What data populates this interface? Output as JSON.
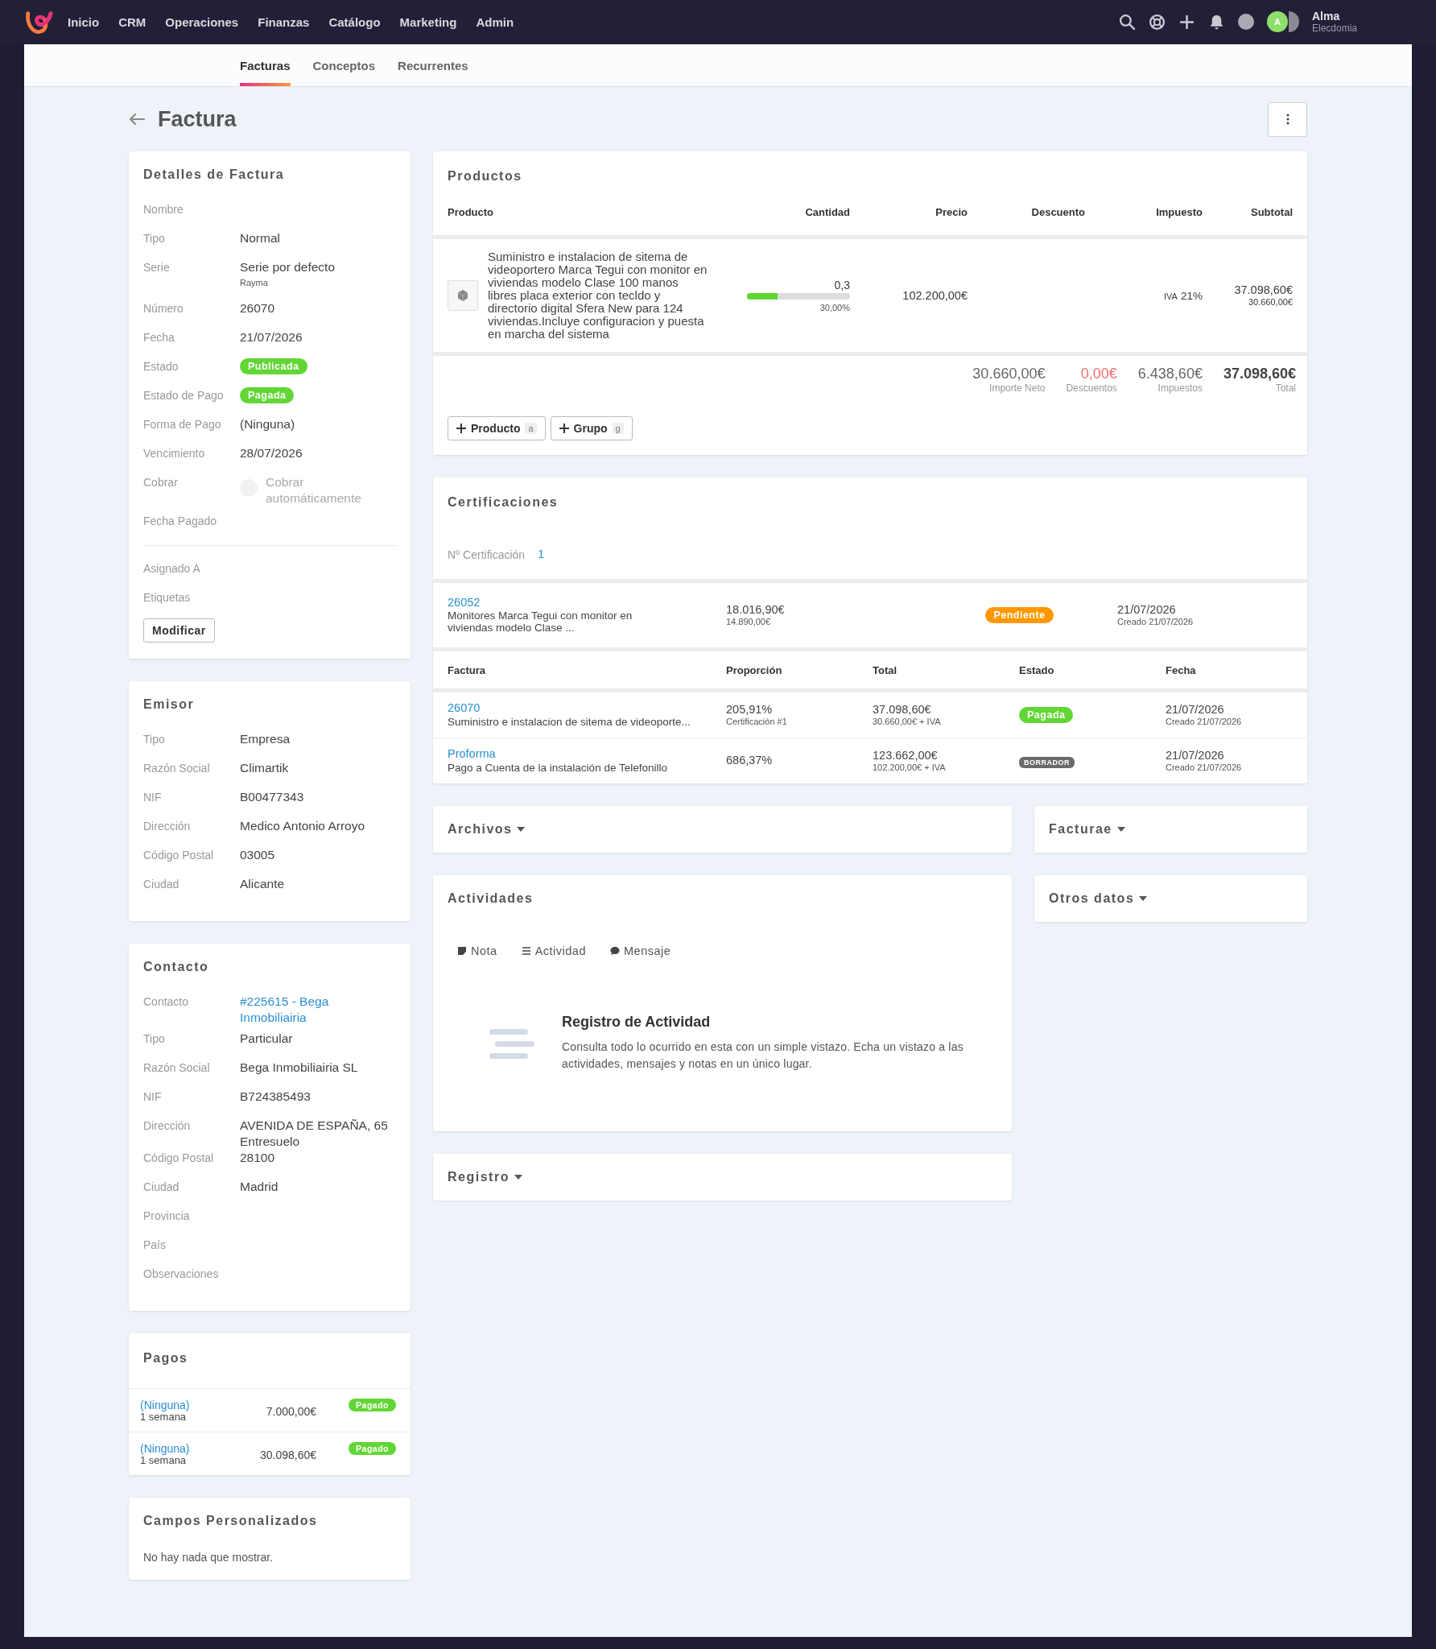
{
  "nav": {
    "items": [
      {
        "label": "Inicio"
      },
      {
        "label": "CRM"
      },
      {
        "label": "Operaciones"
      },
      {
        "label": "Finanzas"
      },
      {
        "label": "Catálogo"
      },
      {
        "label": "Marketing"
      },
      {
        "label": "Admin"
      }
    ],
    "user": {
      "name": "Alma",
      "company": "Elecdomia",
      "initial": "A"
    }
  },
  "tabs": [
    {
      "label": "Facturas",
      "selected": true
    },
    {
      "label": "Conceptos",
      "selected": false
    },
    {
      "label": "Recurrentes",
      "selected": false
    }
  ],
  "page": {
    "title": "Factura"
  },
  "details": {
    "title": "Detalles de Factura",
    "fields": [
      {
        "label": "Nombre"
      },
      {
        "label": "Tipo",
        "kind": "text",
        "value": "Normal"
      },
      {
        "label": "Serie",
        "kind": "text",
        "value": "Serie por defecto",
        "sub": "Rayma"
      },
      {
        "label": "Número",
        "kind": "text",
        "value": "26070"
      },
      {
        "label": "Fecha",
        "kind": "text",
        "value": "21/07/2026"
      },
      {
        "label": "Estado",
        "kind": "badge",
        "value": "Publicada",
        "color": "#62d634"
      },
      {
        "label": "Estado de Pago",
        "kind": "badge",
        "value": "Pagada",
        "color": "#62d634"
      },
      {
        "label": "Forma de Pago",
        "kind": "text",
        "value": "(Ninguna)"
      },
      {
        "label": "Vencimiento",
        "kind": "text",
        "value": "28/07/2026"
      },
      {
        "label": "Cobrar",
        "kind": "toggle",
        "value": "Cobrar automáticamente",
        "on": false
      },
      {
        "label": "Fecha Pagado"
      }
    ],
    "more_fields": [
      {
        "label": "Asignado A"
      },
      {
        "label": "Etiquetas"
      }
    ],
    "button": "Modificar"
  },
  "emisor": {
    "title": "Emisor",
    "fields": [
      {
        "label": "Tipo",
        "kind": "text",
        "value": "Empresa"
      },
      {
        "label": "Razón Social",
        "kind": "text",
        "value": "Climartik"
      },
      {
        "label": "NIF",
        "kind": "text",
        "value": "B00477343"
      },
      {
        "label": "Dirección",
        "kind": "text",
        "value": "Medico Antonio Arroyo"
      },
      {
        "label": "Código Postal",
        "kind": "text",
        "value": "03005"
      },
      {
        "label": "Ciudad",
        "kind": "text",
        "value": "Alicante"
      }
    ]
  },
  "contacto": {
    "title": "Contacto",
    "fields": [
      {
        "label": "Contacto",
        "kind": "link",
        "value": "#225615 - Bega Inmobiliairia"
      },
      {
        "label": "Tipo",
        "kind": "text",
        "value": "Particular"
      },
      {
        "label": "Razón Social",
        "kind": "text",
        "value": "Bega Inmobiliairia SL"
      },
      {
        "label": "NIF",
        "kind": "text",
        "value": "B724385493"
      },
      {
        "label": "Dirección",
        "kind": "text",
        "value": "AVENIDA DE ESPAÑA, 65 Entresuelo"
      },
      {
        "label": "Código Postal",
        "kind": "text",
        "value": "28100"
      },
      {
        "label": "Ciudad",
        "kind": "text",
        "value": "Madrid"
      },
      {
        "label": "Provincia"
      },
      {
        "label": "País"
      },
      {
        "label": "Observaciones"
      }
    ]
  },
  "pagos": {
    "title": "Pagos",
    "rows": [
      {
        "method": "(Ninguna)",
        "term": "1 semana",
        "amount": "7.000,00€",
        "status": "Pagado",
        "color": "#62d634"
      },
      {
        "method": "(Ninguna)",
        "term": "1 semana",
        "amount": "30.098,60€",
        "status": "Pagado",
        "color": "#62d634"
      }
    ]
  },
  "custom": {
    "title": "Campos Personalizados",
    "empty": "No hay nada que mostrar."
  },
  "productos": {
    "title": "Productos",
    "columns": [
      "Producto",
      "Cantidad",
      "Precio",
      "Descuento",
      "Impuesto",
      "Subtotal"
    ],
    "rows": [
      {
        "description": "Suministro e instalacion de sitema de videoportero Marca Tegui con monitor en viviendas modelo Clase 100 manos libres placa exterior con tecldo y directorio digital Sfera New para 124 viviendas.Incluye configuracion y puesta en marcha del sistema",
        "quantity": "0,3",
        "level": 0.3,
        "quantity_pct": "30,00%",
        "price": "102.200,00€",
        "tax_label": "IVA",
        "tax_rate": "21%",
        "subtotal": "37.098,60€",
        "subtotal_net": "30.660,00€"
      }
    ],
    "totals": [
      {
        "value": "30.660,00€",
        "label": "Importe Neto",
        "kind": "normal"
      },
      {
        "value": "0,00€",
        "label": "Descuentos",
        "kind": "negative"
      },
      {
        "value": "6.438,60€",
        "label": "Impuestos",
        "kind": "normal"
      },
      {
        "value": "37.098,60€",
        "label": "Total",
        "kind": "total"
      }
    ],
    "buttons": [
      {
        "label": "Producto",
        "key": "a"
      },
      {
        "label": "Grupo",
        "key": "g"
      }
    ]
  },
  "certificaciones": {
    "title": "Certificaciones",
    "number_label": "Nº Certificación",
    "number": "1",
    "item": {
      "id": "26052",
      "description": "Monitores Marca Tegui con monitor en viviendas modelo Clase ...",
      "amount": "18.016,90€",
      "net": "14.890,00€",
      "status": "Pendiente",
      "color": "#ff9800",
      "date": "21/07/2026",
      "created": "Creado 21/07/2026"
    },
    "columns": [
      "Factura",
      "Proporción",
      "Total",
      "Estado",
      "Fecha"
    ],
    "rows": [
      {
        "id": "26070",
        "description": "Suministro e instalacion de sitema de videoporte...",
        "proportion": "205,91%",
        "proportion_sub": "Certificación #1",
        "total": "37.098,60€",
        "total_sub": "30.660,00€ + IVA",
        "status": "Pagada",
        "kind": "pill",
        "color": "#62d634",
        "date": "21/07/2026",
        "created": "Creado 21/07/2026"
      },
      {
        "id": "Proforma",
        "description": "Pago a Cuenta de la instalación de Telefonillo",
        "proportion": "686,37%",
        "total": "123.662,00€",
        "total_sub": "102.200,00€ + IVA",
        "status": "BORRADOR",
        "kind": "tag",
        "color": "#6b6b6b",
        "date": "21/07/2026",
        "created": "Creado 21/07/2026"
      }
    ]
  },
  "archivos": {
    "title": "Archivos"
  },
  "facturae": {
    "title": "Facturae"
  },
  "actividades": {
    "title": "Actividades",
    "tabs": [
      {
        "label": "Nota",
        "kind": "note"
      },
      {
        "label": "Actividad",
        "kind": "list"
      },
      {
        "label": "Mensaje",
        "kind": "chat"
      }
    ],
    "empty_title": "Registro de Actividad",
    "empty_text": "Consulta todo lo ocurrido en esta con un simple vistazo. Echa un vistazo a las actividades, mensajes y notas en un único lugar."
  },
  "otros": {
    "title": "Otros datos"
  },
  "registro": {
    "title": "Registro"
  }
}
